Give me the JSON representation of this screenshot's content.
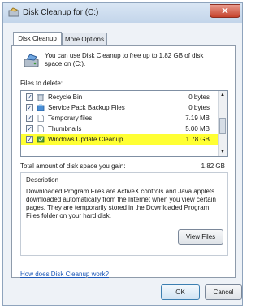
{
  "window": {
    "title": "Disk Cleanup for  (C:)",
    "close_label": "✕"
  },
  "tabs": [
    {
      "label": "Disk Cleanup",
      "active": true
    },
    {
      "label": "More Options",
      "active": false
    }
  ],
  "intro": {
    "text": "You can use Disk Cleanup to free up to 1.82 GB of disk space on  (C:)."
  },
  "files": {
    "label": "Files to delete:",
    "items": [
      {
        "name": "Recycle Bin",
        "size": "0 bytes",
        "checked": true,
        "icon": "recycle-bin-icon"
      },
      {
        "name": "Service Pack Backup Files",
        "size": "0 bytes",
        "checked": true,
        "icon": "backup-files-icon"
      },
      {
        "name": "Temporary files",
        "size": "7.19 MB",
        "checked": true,
        "icon": "file-icon"
      },
      {
        "name": "Thumbnails",
        "size": "5.00 MB",
        "checked": true,
        "icon": "file-icon"
      },
      {
        "name": "Windows Update Cleanup",
        "size": "1.78 GB",
        "checked": true,
        "icon": "windows-update-icon",
        "highlighted": true
      }
    ]
  },
  "total": {
    "label": "Total amount of disk space you gain:",
    "value": "1.82 GB"
  },
  "description": {
    "title": "Description",
    "text": "Downloaded Program Files are ActiveX controls and Java applets downloaded automatically from the Internet when you view certain pages. They are temporarily stored in the Downloaded Program Files folder on your hard disk."
  },
  "buttons": {
    "view_files": "View Files",
    "ok": "OK",
    "cancel": "Cancel"
  },
  "help_link": "How does Disk Cleanup work?",
  "colors": {
    "highlight": "#ffff33",
    "link": "#1b57b7"
  }
}
